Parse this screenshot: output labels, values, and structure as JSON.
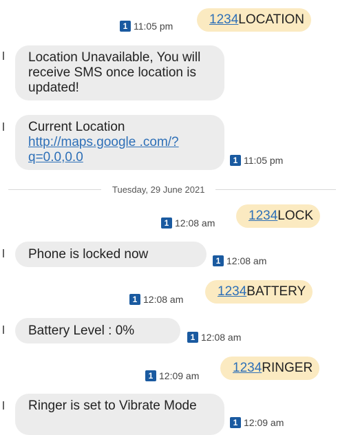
{
  "sim_badge": "1",
  "messages": [
    {
      "number": "1234",
      "command": "LOCATION",
      "time": "11:05 pm"
    },
    {
      "text": "Location Unavailable, You will receive SMS once location is updated!"
    },
    {
      "text": "Current Location",
      "link": "http://maps.google .com/?q=0.0,0.0",
      "time": "11:05 pm"
    },
    {
      "number": "1234",
      "command": "LOCK",
      "time": "12:08 am"
    },
    {
      "text": "Phone is locked now",
      "time": "12:08 am"
    },
    {
      "number": "1234",
      "command": "BATTERY",
      "time": "12:08 am"
    },
    {
      "text": "Battery Level : 0%",
      "time": "12:08 am"
    },
    {
      "number": "1234",
      "command": "RINGER",
      "time": "12:09 am"
    },
    {
      "text": "Ringer is set to Vibrate Mode",
      "time": "12:09 am"
    }
  ],
  "date_divider": "Tuesday, 29 June 2021"
}
